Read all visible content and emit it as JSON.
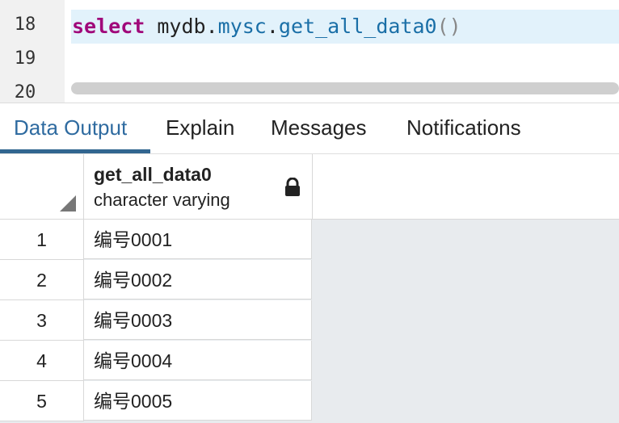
{
  "editor": {
    "line_numbers": [
      "18",
      "19",
      "20"
    ],
    "code": {
      "keyword": "select",
      "object_prefix": "mydb.",
      "schema": "mysc",
      "dot": ".",
      "function": "get_all_data0",
      "parens": "()"
    }
  },
  "tabs": [
    {
      "label": "Data Output",
      "active": true
    },
    {
      "label": "Explain",
      "active": false
    },
    {
      "label": "Messages",
      "active": false
    },
    {
      "label": "Notifications",
      "active": false
    }
  ],
  "grid": {
    "column": {
      "name": "get_all_data0",
      "type": "character varying",
      "icon": "lock-icon"
    },
    "rows": [
      {
        "num": "1",
        "value": "编号0001"
      },
      {
        "num": "2",
        "value": "编号0002"
      },
      {
        "num": "3",
        "value": "编号0003"
      },
      {
        "num": "4",
        "value": "编号0004"
      },
      {
        "num": "5",
        "value": "编号0005"
      }
    ]
  },
  "colors": {
    "accent": "#326690",
    "keyword": "#a0087a",
    "identifier": "#1a6fa7"
  }
}
